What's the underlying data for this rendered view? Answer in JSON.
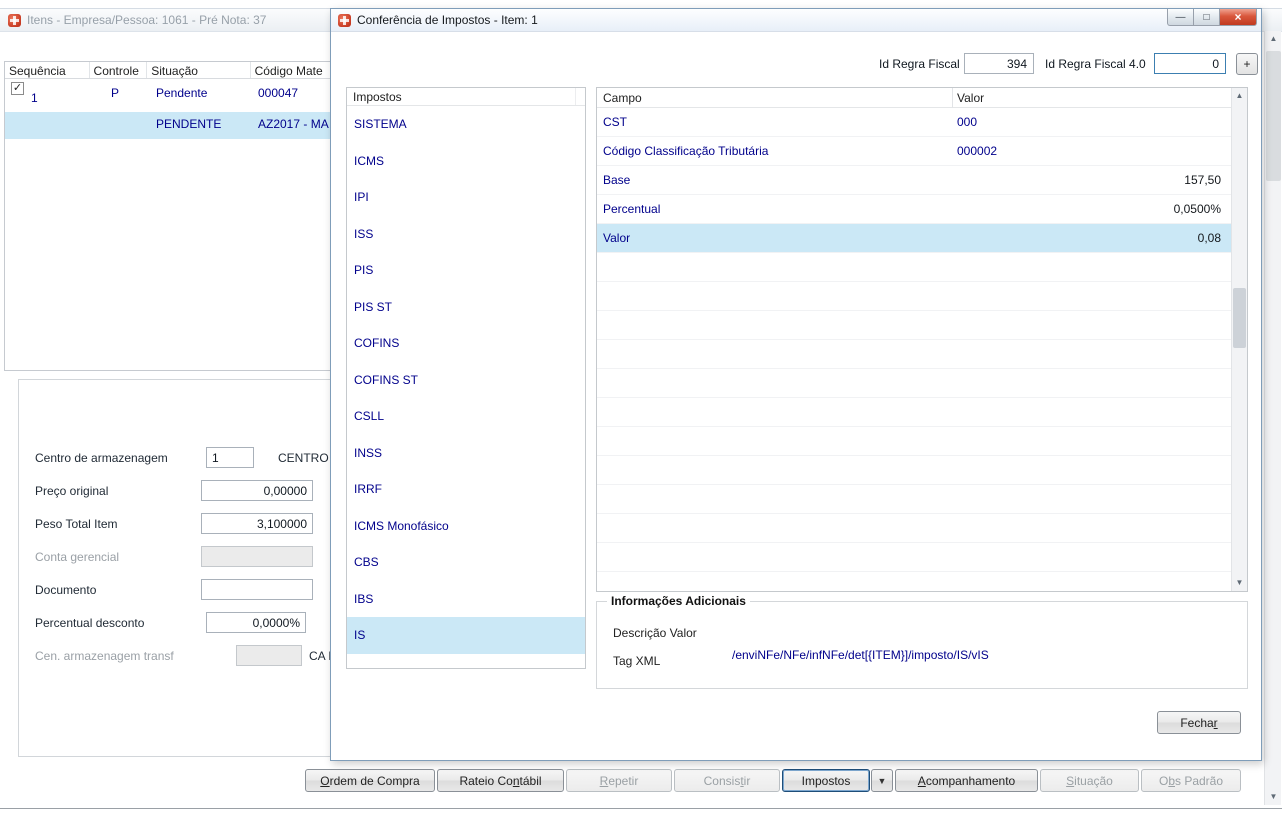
{
  "icons": {
    "dropdown": "▼",
    "minimize": "—",
    "maximize": "□",
    "close": "×",
    "check": "✓",
    "scroll_up": "▲",
    "scroll_down": "▼"
  },
  "background_window": {
    "title": "Itens - Empresa/Pessoa: 1061 - Pré Nota: 37",
    "grid": {
      "columns": [
        "Sequência",
        "Controle",
        "Situação",
        "Código Mate"
      ],
      "row1": {
        "checked": true,
        "sequencia": "1",
        "controle": "P",
        "situacao": "Pendente",
        "codigo": "000047"
      },
      "row2": {
        "situacao": "PENDENTE",
        "codigo": "AZ2017 - MA"
      }
    },
    "form": {
      "fields": [
        {
          "label": "Centro de armazenagem",
          "value": "1",
          "suffix": "CENTRO",
          "disabled": false,
          "align": "left"
        },
        {
          "label": "Preço original",
          "value": "0,00000",
          "disabled": false,
          "align": "right"
        },
        {
          "label": "Peso Total Item",
          "value": "3,100000",
          "disabled": false,
          "align": "right"
        },
        {
          "label": "Conta gerencial",
          "value": "",
          "disabled": true,
          "align": "left"
        },
        {
          "label": "Documento",
          "value": "",
          "disabled": false,
          "align": "left"
        },
        {
          "label": "Percentual desconto",
          "value": "0,0000%",
          "disabled": false,
          "align": "right"
        },
        {
          "label": "Cen. armazenagem transf",
          "value": "",
          "suffix": "CA EMBR",
          "disabled": true,
          "align": "left"
        }
      ]
    },
    "buttons": [
      {
        "label": "Ordem de Compra",
        "u": 0,
        "enabled": true
      },
      {
        "label": "Rateio Contábil",
        "u": 9,
        "enabled": true
      },
      {
        "label": "Repetir",
        "u": 0,
        "enabled": false
      },
      {
        "label": "Consistir",
        "u": 6,
        "enabled": false
      },
      {
        "label": "Impostos",
        "u": -1,
        "enabled": true,
        "focused": true
      },
      {
        "label": "Acompanhamento",
        "u": 0,
        "enabled": true
      },
      {
        "label": "Situação",
        "u": 0,
        "enabled": false
      },
      {
        "label": "Obs Padrão",
        "u": 1,
        "enabled": false
      }
    ]
  },
  "modal": {
    "title": "Conferência de Impostos - Item: 1",
    "fields": {
      "id_regra_fiscal_label": "Id Regra Fiscal",
      "id_regra_fiscal_value": "394",
      "id_regra_fiscal40_label": "Id Regra Fiscal 4.0",
      "id_regra_fiscal40_value": "0",
      "add_button": "+"
    },
    "impostos": {
      "header": "Impostos",
      "selected": "IS",
      "items": [
        "SISTEMA",
        "ICMS",
        "IPI",
        "ISS",
        "PIS",
        "PIS ST",
        "COFINS",
        "COFINS ST",
        "CSLL",
        "INSS",
        "IRRF",
        "ICMS Monofásico",
        "CBS",
        "IBS",
        "IS"
      ]
    },
    "detail_table": {
      "columns": [
        "Campo",
        "Valor"
      ],
      "rows": [
        {
          "campo": "CST",
          "valor": "000",
          "align": "left"
        },
        {
          "campo": "Código Classificação Tributária",
          "valor": "000002",
          "align": "left"
        },
        {
          "campo": "Base",
          "valor": "157,50",
          "align": "right"
        },
        {
          "campo": "Percentual",
          "valor": "0,0500%",
          "align": "right"
        },
        {
          "campo": "Valor",
          "valor": "0,08",
          "align": "right",
          "selected": true
        }
      ]
    },
    "info": {
      "title": "Informações Adicionais",
      "descricao": "Descrição Valor",
      "tag_xml_label": "Tag XML",
      "tag_xml_value": "/enviNFe/NFe/infNFe/det[{ITEM}]/imposto/IS/vIS"
    },
    "fechar": {
      "label": "Fechar",
      "u": 5
    }
  }
}
